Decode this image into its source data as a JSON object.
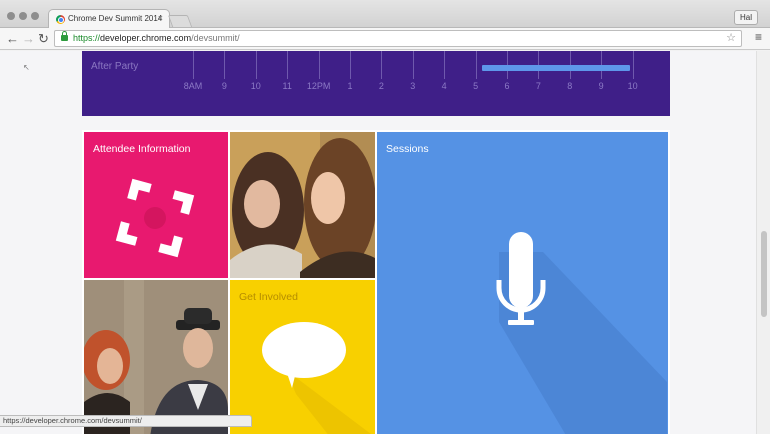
{
  "browser": {
    "tab": {
      "title": "Chrome Dev Summit 2014",
      "close_glyph": "×"
    },
    "profile_name": "Hal",
    "toolbar": {
      "back_glyph": "←",
      "forward_glyph": "→",
      "reload_glyph": "↻",
      "star_glyph": "☆",
      "menu_glyph": "≡"
    },
    "address": {
      "scheme": "https://",
      "host": "developer.chrome.com",
      "path": "/devsummit/"
    },
    "status_url": "https://developer.chrome.com/devsummit/"
  },
  "schedule": {
    "track_label": "After Party",
    "times": [
      "8AM",
      "9",
      "10",
      "11",
      "12PM",
      "1",
      "2",
      "3",
      "4",
      "5",
      "6",
      "7",
      "8",
      "9",
      "10"
    ],
    "bar_color": "#5e97ea",
    "background": "#3f1f88"
  },
  "tiles": {
    "attendee": {
      "title": "Attendee Information",
      "color": "#e8196f",
      "icon": "frame-icon"
    },
    "sessions": {
      "title": "Sessions",
      "color": "#5592e4",
      "icon": "microphone-icon"
    },
    "involved": {
      "title": "Get Involved",
      "color": "#f8d000",
      "icon": "speech-bubble-icon"
    }
  }
}
